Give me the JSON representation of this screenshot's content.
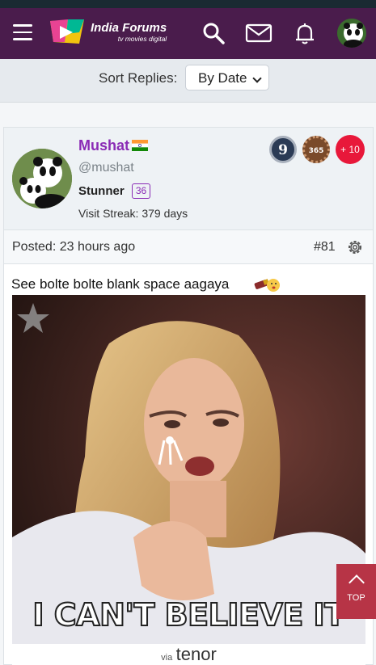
{
  "header": {
    "logo_title": "India Forums",
    "logo_sub": "tv  movies  digital"
  },
  "sort": {
    "label": "Sort Replies:",
    "selected": "By Date"
  },
  "post": {
    "username": "Mushat",
    "handle": "@mushat",
    "rank": "Stunner",
    "rank_level": "36",
    "streak": "Visit Streak: 379 days",
    "badges": [
      "9",
      "365"
    ],
    "more_badges": "+ 10",
    "posted": "Posted: 23 hours ago",
    "post_number": "#81",
    "content": "See bolte bolte blank space aagaya",
    "gif_caption": "I CAN'T BELIEVE IT",
    "gif_via": "via",
    "gif_source": "tenor"
  },
  "top_button": "TOP",
  "colors": {
    "header_bg": "#4a1c4c",
    "username": "#8a2bb5",
    "top_button_bg": "#b73446",
    "badge_red": "#e8183a"
  }
}
